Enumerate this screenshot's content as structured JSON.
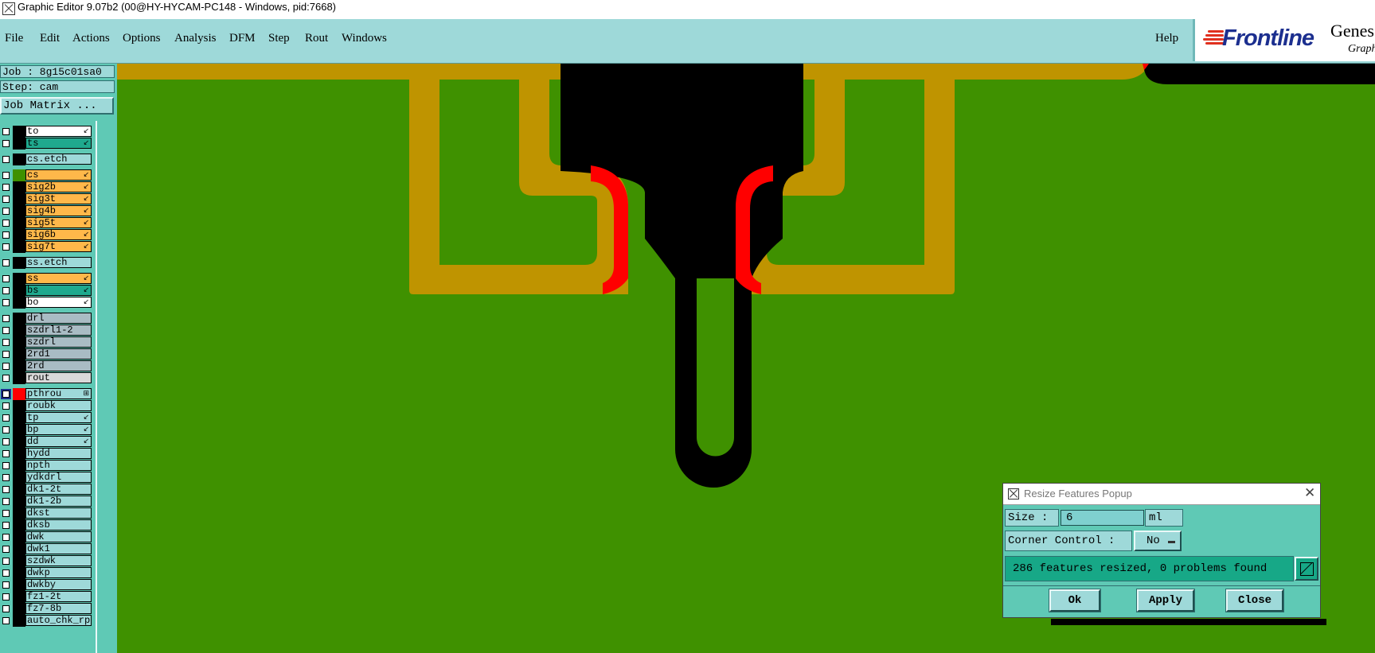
{
  "window": {
    "title": "Graphic Editor 9.07b2 (00@HY-HYCAM-PC148 - Windows, pid:7668)"
  },
  "menu": {
    "file": "File",
    "edit": "Edit",
    "actions": "Actions",
    "options": "Options",
    "analysis": "Analysis",
    "dfm": "DFM",
    "step": "Step",
    "rout": "Rout",
    "windows": "Windows",
    "help": "Help"
  },
  "logo": {
    "brand": "Frontline",
    "product": "Genes",
    "sub": "Graph"
  },
  "sidebar": {
    "job": "Job : 8g15c01sa0",
    "step": "Step: cam",
    "job_matrix": "Job Matrix ...",
    "layers": [
      {
        "name": "to",
        "color": "#ffffff",
        "swatch": "#000000",
        "icon": "↙"
      },
      {
        "name": "ts",
        "color": "#1fa98e",
        "swatch": "#000000",
        "icon": "↙"
      },
      {
        "name": "cs.etch",
        "color": "#9ed9d9",
        "swatch": "#000000",
        "icon": ""
      },
      {
        "name": "cs",
        "color": "#ffb84a",
        "swatch": "#3f9100",
        "icon": "↙"
      },
      {
        "name": "sig2b",
        "color": "#ffb84a",
        "swatch": "#000000",
        "icon": "↙"
      },
      {
        "name": "sig3t",
        "color": "#ffb84a",
        "swatch": "#000000",
        "icon": "↙"
      },
      {
        "name": "sig4b",
        "color": "#ffb84a",
        "swatch": "#000000",
        "icon": "↙"
      },
      {
        "name": "sig5t",
        "color": "#ffb84a",
        "swatch": "#000000",
        "icon": "↙"
      },
      {
        "name": "sig6b",
        "color": "#ffb84a",
        "swatch": "#000000",
        "icon": "↙"
      },
      {
        "name": "sig7t",
        "color": "#ffb84a",
        "swatch": "#000000",
        "icon": "↙"
      },
      {
        "name": "ss.etch",
        "color": "#9ed9d9",
        "swatch": "#000000",
        "icon": ""
      },
      {
        "name": "ss",
        "color": "#ffb84a",
        "swatch": "#000000",
        "icon": "↙"
      },
      {
        "name": "bs",
        "color": "#1fa98e",
        "swatch": "#000000",
        "icon": "↙"
      },
      {
        "name": "bo",
        "color": "#ffffff",
        "swatch": "#000000",
        "icon": "↙"
      },
      {
        "name": "drl",
        "color": "#a9bcc4",
        "swatch": "#000000",
        "icon": ""
      },
      {
        "name": "szdrl1-2",
        "color": "#a9bcc4",
        "swatch": "#000000",
        "icon": ""
      },
      {
        "name": "szdrl",
        "color": "#a9bcc4",
        "swatch": "#000000",
        "icon": ""
      },
      {
        "name": "2rd1",
        "color": "#a9bcc4",
        "swatch": "#000000",
        "icon": ""
      },
      {
        "name": "2rd",
        "color": "#a9bcc4",
        "swatch": "#000000",
        "icon": ""
      },
      {
        "name": "rout",
        "color": "#d9d9d9",
        "swatch": "#000000",
        "icon": ""
      },
      {
        "name": "pthrou",
        "color": "#9ed9d9",
        "swatch": "#ff0000",
        "icon": "⊞",
        "active": true
      },
      {
        "name": "roubk",
        "color": "#9ed9d9",
        "swatch": "#000000",
        "icon": ""
      },
      {
        "name": "tp",
        "color": "#9ed9d9",
        "swatch": "#000000",
        "icon": "↙"
      },
      {
        "name": "bp",
        "color": "#9ed9d9",
        "swatch": "#000000",
        "icon": "↙"
      },
      {
        "name": "dd",
        "color": "#9ed9d9",
        "swatch": "#000000",
        "icon": "↙"
      },
      {
        "name": "hydd",
        "color": "#9ed9d9",
        "swatch": "#000000",
        "icon": ""
      },
      {
        "name": "npth",
        "color": "#9ed9d9",
        "swatch": "#000000",
        "icon": ""
      },
      {
        "name": "ydkdrl",
        "color": "#9ed9d9",
        "swatch": "#000000",
        "icon": ""
      },
      {
        "name": "dk1-2t",
        "color": "#9ed9d9",
        "swatch": "#000000",
        "icon": ""
      },
      {
        "name": "dk1-2b",
        "color": "#9ed9d9",
        "swatch": "#000000",
        "icon": ""
      },
      {
        "name": "dkst",
        "color": "#9ed9d9",
        "swatch": "#000000",
        "icon": ""
      },
      {
        "name": "dksb",
        "color": "#9ed9d9",
        "swatch": "#000000",
        "icon": ""
      },
      {
        "name": "dwk",
        "color": "#9ed9d9",
        "swatch": "#000000",
        "icon": ""
      },
      {
        "name": "dwk1",
        "color": "#9ed9d9",
        "swatch": "#000000",
        "icon": ""
      },
      {
        "name": "szdwk",
        "color": "#9ed9d9",
        "swatch": "#000000",
        "icon": ""
      },
      {
        "name": "dwkp",
        "color": "#9ed9d9",
        "swatch": "#000000",
        "icon": ""
      },
      {
        "name": "dwkby",
        "color": "#9ed9d9",
        "swatch": "#000000",
        "icon": ""
      },
      {
        "name": "fz1-2t",
        "color": "#9ed9d9",
        "swatch": "#000000",
        "icon": ""
      },
      {
        "name": "fz7-8b",
        "color": "#9ed9d9",
        "swatch": "#000000",
        "icon": ""
      },
      {
        "name": "auto_chk_rp",
        "color": "#9ed9d9",
        "swatch": "#000000",
        "icon": ""
      }
    ]
  },
  "canvas": {
    "colors": {
      "background": "#3f9100",
      "outline": "#bf9400",
      "copper": "#000000",
      "highlight": "#ff0000"
    }
  },
  "dialog": {
    "title": "Resize Features Popup",
    "size_label": "Size :",
    "size_value": "6",
    "size_unit": "ml",
    "corner_label": "Corner Control :",
    "corner_value": "No",
    "status": "286 features resized, 0 problems found",
    "ok": "Ok",
    "apply": "Apply",
    "close": "Close"
  }
}
